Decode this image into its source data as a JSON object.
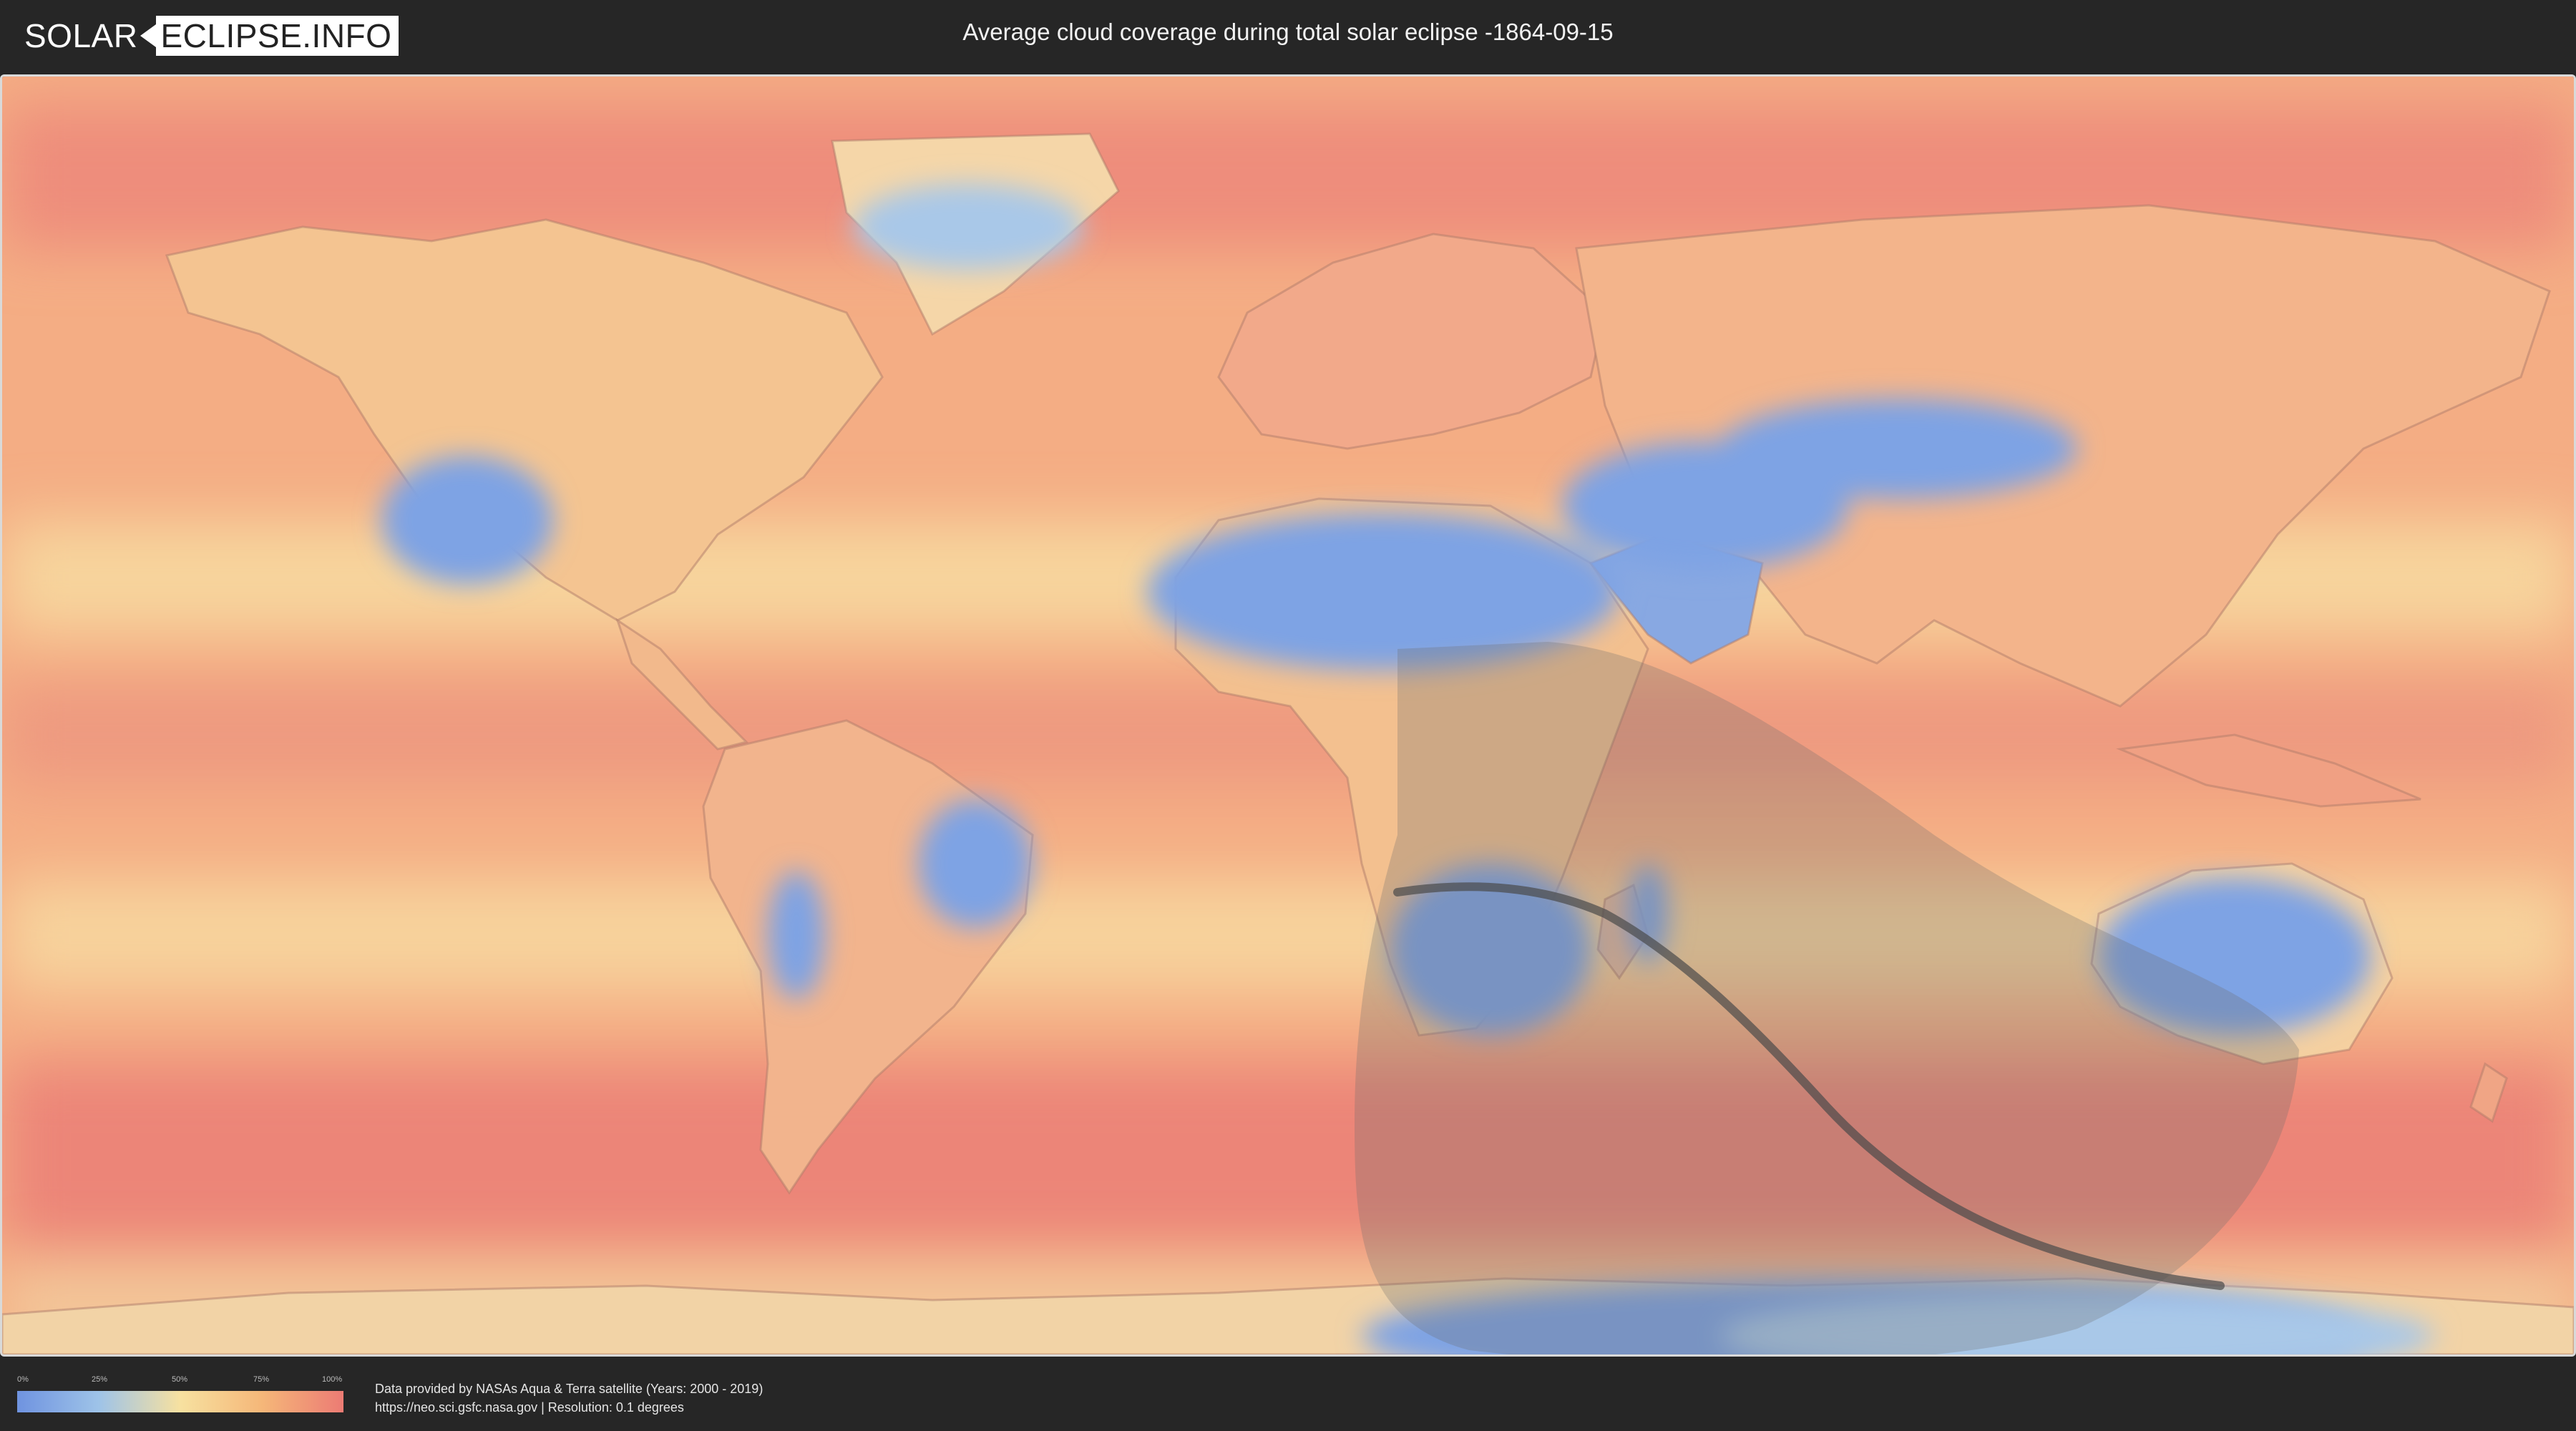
{
  "logo": {
    "left": "SOLAR",
    "right": "ECLIPSE.INFO"
  },
  "title": "Average cloud coverage during total solar eclipse -1864-09-15",
  "legend": {
    "ticks": [
      "0%",
      "25%",
      "50%",
      "75%",
      "100%"
    ],
    "colors": [
      "#6f93e0",
      "#9ec3e8",
      "#f7e1a0",
      "#f5b779",
      "#ec7b74"
    ]
  },
  "credit": {
    "line1": "Data provided by NASAs Aqua & Terra satellite (Years: 2000 - 2019)",
    "line2": "https://neo.sci.gsfc.nasa.gov | Resolution: 0.1 degrees"
  },
  "map": {
    "palette": {
      "ocean_cloudy": "#ef8f7c",
      "ocean_mid": "#f6c28c",
      "clear": "#7fa6e6",
      "partial": "#f5dca3",
      "eclipse_shadow": "#6b6b6b",
      "central_path": "#4a4a4a"
    }
  }
}
